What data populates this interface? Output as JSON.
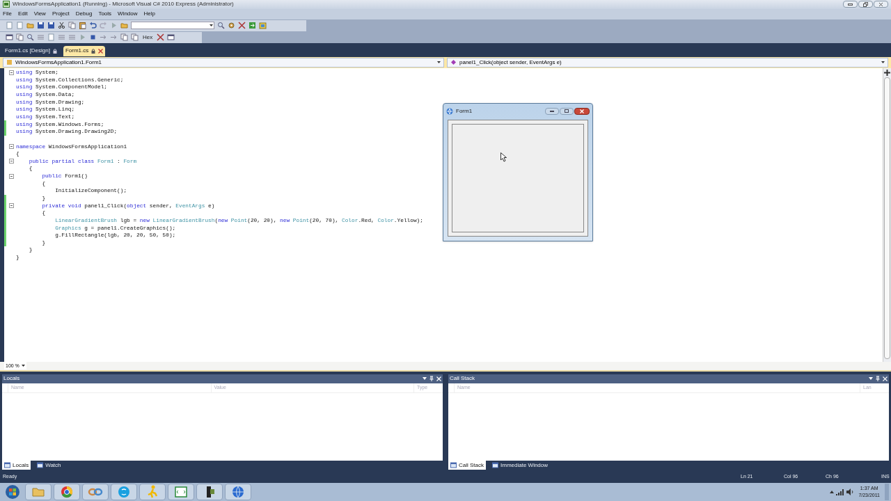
{
  "window": {
    "title": "WindowsFormsApplication1 (Running) - Microsoft Visual C# 2010 Express (Administrator)"
  },
  "menu": [
    "File",
    "Edit",
    "View",
    "Project",
    "Debug",
    "Tools",
    "Window",
    "Help"
  ],
  "toolbar": {
    "hex_label": "Hex"
  },
  "doc_tabs": [
    {
      "label": "Form1.cs [Design]",
      "selected": false
    },
    {
      "label": "Form1.cs",
      "selected": true
    }
  ],
  "nav": {
    "type_combo": "WindowsFormsApplication1.Form1",
    "member_combo": "panel1_Click(object sender, EventArgs e)"
  },
  "code": [
    {
      "fold": true,
      "changed": false,
      "tokens": [
        {
          "kind": "keyword",
          "t": "using"
        },
        {
          "kind": "plain",
          "t": " System;"
        }
      ]
    },
    {
      "fold": false,
      "changed": false,
      "tokens": [
        {
          "kind": "keyword",
          "t": "using"
        },
        {
          "kind": "plain",
          "t": " System.Collections.Generic;"
        }
      ]
    },
    {
      "fold": false,
      "changed": false,
      "tokens": [
        {
          "kind": "keyword",
          "t": "using"
        },
        {
          "kind": "plain",
          "t": " System.ComponentModel;"
        }
      ]
    },
    {
      "fold": false,
      "changed": false,
      "tokens": [
        {
          "kind": "keyword",
          "t": "using"
        },
        {
          "kind": "plain",
          "t": " System.Data;"
        }
      ]
    },
    {
      "fold": false,
      "changed": false,
      "tokens": [
        {
          "kind": "keyword",
          "t": "using"
        },
        {
          "kind": "plain",
          "t": " System.Drawing;"
        }
      ]
    },
    {
      "fold": false,
      "changed": false,
      "tokens": [
        {
          "kind": "keyword",
          "t": "using"
        },
        {
          "kind": "plain",
          "t": " System.Linq;"
        }
      ]
    },
    {
      "fold": false,
      "changed": false,
      "tokens": [
        {
          "kind": "keyword",
          "t": "using"
        },
        {
          "kind": "plain",
          "t": " System.Text;"
        }
      ]
    },
    {
      "fold": false,
      "changed": true,
      "tokens": [
        {
          "kind": "keyword",
          "t": "using"
        },
        {
          "kind": "plain",
          "t": " System.Windows.Forms;"
        }
      ]
    },
    {
      "fold": false,
      "changed": true,
      "tokens": [
        {
          "kind": "keyword",
          "t": "using"
        },
        {
          "kind": "plain",
          "t": " System.Drawing.Drawing2D;"
        }
      ]
    },
    {
      "fold": false,
      "changed": false
    },
    {
      "fold": true,
      "changed": false,
      "tokens": [
        {
          "kind": "keyword",
          "t": "namespace"
        },
        {
          "kind": "plain",
          "t": " WindowsFormsApplication1"
        }
      ]
    },
    {
      "fold": false,
      "changed": false,
      "tokens": [
        {
          "kind": "plain",
          "t": "{"
        }
      ]
    },
    {
      "fold": true,
      "changed": false,
      "tokens": [
        {
          "kind": "keyword",
          "t": "    public partial class"
        },
        {
          "kind": "type",
          "t": " Form1"
        },
        {
          "kind": "plain",
          "t": " : "
        },
        {
          "kind": "type",
          "t": "Form"
        }
      ]
    },
    {
      "fold": false,
      "changed": false,
      "tokens": [
        {
          "kind": "plain",
          "t": "    {"
        }
      ]
    },
    {
      "fold": true,
      "changed": false,
      "tokens": [
        {
          "kind": "keyword",
          "t": "        public"
        },
        {
          "kind": "plain",
          "t": " Form1()"
        }
      ]
    },
    {
      "fold": false,
      "changed": false,
      "tokens": [
        {
          "kind": "plain",
          "t": "        {"
        }
      ]
    },
    {
      "fold": false,
      "changed": false,
      "tokens": [
        {
          "kind": "plain",
          "t": "            InitializeComponent();"
        }
      ]
    },
    {
      "fold": false,
      "changed": true,
      "tokens": [
        {
          "kind": "plain",
          "t": "        }"
        }
      ]
    },
    {
      "fold": true,
      "changed": true,
      "tokens": [
        {
          "kind": "keyword",
          "t": "        private void"
        },
        {
          "kind": "plain",
          "t": " panel1_Click("
        },
        {
          "kind": "keyword",
          "t": "object"
        },
        {
          "kind": "plain",
          "t": " sender, "
        },
        {
          "kind": "type",
          "t": "EventArgs"
        },
        {
          "kind": "plain",
          "t": " e)"
        }
      ]
    },
    {
      "fold": false,
      "changed": true,
      "tokens": [
        {
          "kind": "plain",
          "t": "        {"
        }
      ]
    },
    {
      "fold": false,
      "changed": true,
      "tokens": [
        {
          "kind": "type",
          "t": "            LinearGradientBrush"
        },
        {
          "kind": "plain",
          "t": " lgb = "
        },
        {
          "kind": "keyword",
          "t": "new"
        },
        {
          "kind": "type",
          "t": " LinearGradientBrush"
        },
        {
          "kind": "plain",
          "t": "("
        },
        {
          "kind": "keyword",
          "t": "new"
        },
        {
          "kind": "type",
          "t": " Point"
        },
        {
          "kind": "plain",
          "t": "(20, 20), "
        },
        {
          "kind": "keyword",
          "t": "new"
        },
        {
          "kind": "type",
          "t": " Point"
        },
        {
          "kind": "plain",
          "t": "(20, 70), "
        },
        {
          "kind": "type",
          "t": "Color"
        },
        {
          "kind": "plain",
          "t": ".Red, "
        },
        {
          "kind": "type",
          "t": "Color"
        },
        {
          "kind": "plain",
          "t": ".Yellow);"
        }
      ]
    },
    {
      "fold": false,
      "changed": true,
      "tokens": [
        {
          "kind": "type",
          "t": "            Graphics"
        },
        {
          "kind": "plain",
          "t": " g = panel1.CreateGraphics();"
        }
      ]
    },
    {
      "fold": false,
      "changed": true,
      "tokens": [
        {
          "kind": "plain",
          "t": "            g.FillRectangle(lgb, 20, 20, 50, 50);"
        }
      ]
    },
    {
      "fold": false,
      "changed": true,
      "tokens": [
        {
          "kind": "plain",
          "t": "        }"
        }
      ]
    },
    {
      "fold": false,
      "changed": false,
      "tokens": [
        {
          "kind": "plain",
          "t": "    }"
        }
      ]
    },
    {
      "fold": false,
      "changed": false,
      "tokens": [
        {
          "kind": "plain",
          "t": "}"
        }
      ]
    }
  ],
  "zoom": "100 %",
  "form_window": {
    "title": "Form1"
  },
  "panels": [
    {
      "title": "Locals",
      "columns": [
        "Name",
        "Value",
        "Type"
      ],
      "tabs": [
        {
          "label": "Locals",
          "selected": true
        },
        {
          "label": "Watch",
          "selected": false
        }
      ]
    },
    {
      "title": "Call Stack",
      "columns": [
        "Name",
        "Lan"
      ],
      "tabs": [
        {
          "label": "Call Stack",
          "selected": true
        },
        {
          "label": "Immediate Window",
          "selected": false
        }
      ]
    }
  ],
  "status_bar": {
    "message": "Ready",
    "line": "Ln 21",
    "col": "Col 96",
    "ch": "Ch 96",
    "mode": "INS"
  },
  "taskbar": {
    "time": "1:37 AM",
    "date": "7/23/2011"
  }
}
